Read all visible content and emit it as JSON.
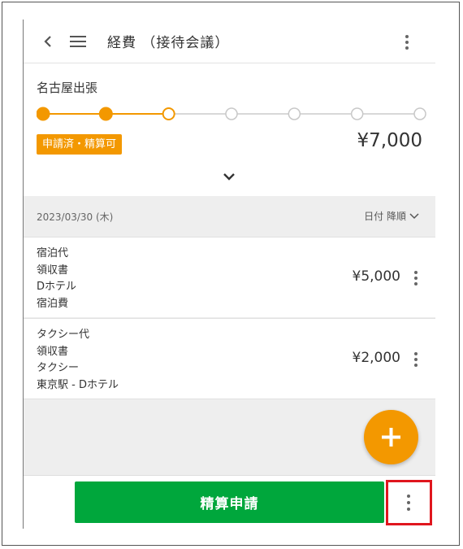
{
  "header": {
    "title": "経費 （接待会議）",
    "back_icon": "chevron-left-icon",
    "menu_icon": "hamburger-menu-icon",
    "more_icon": "vertical-dots-icon"
  },
  "trip": {
    "name": "名古屋出張",
    "progress": {
      "total_steps": 7,
      "completed_steps": 2,
      "current_step": 3
    },
    "status_badge": "申請済・精算可",
    "total": "¥7,000",
    "expand_icon": "chevron-down-icon"
  },
  "list": {
    "date_label": "2023/03/30 (木)",
    "sort_label": "日付 降順",
    "items": [
      {
        "lines": [
          "宿泊代",
          "領収書",
          "Dホテル",
          "宿泊費"
        ],
        "amount": "¥5,000"
      },
      {
        "lines": [
          "タクシー代",
          "領収書",
          "タクシー",
          "東京駅 - Dホテル"
        ],
        "amount": "¥2,000"
      }
    ]
  },
  "fab": {
    "icon": "plus-icon"
  },
  "footer": {
    "submit_label": "精算申請",
    "more_icon": "vertical-dots-icon"
  },
  "colors": {
    "accent": "#f39800",
    "primary_button": "#00a73c",
    "highlight_border": "#e0161e"
  }
}
